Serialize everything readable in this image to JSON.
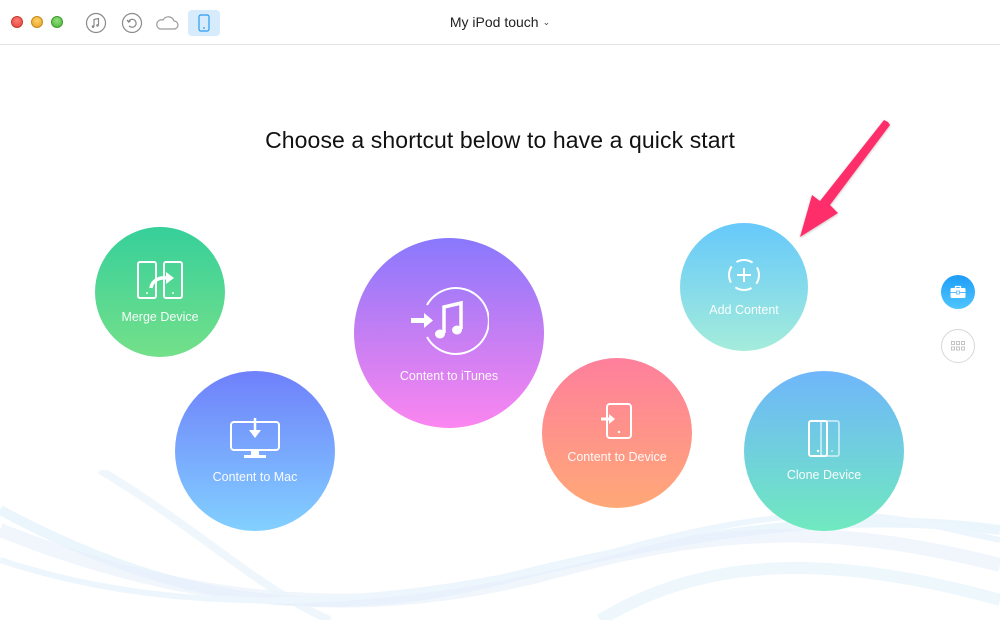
{
  "window": {
    "controls": [
      "close",
      "minimize",
      "maximize"
    ]
  },
  "toolbar": {
    "icons": [
      {
        "name": "itunes-library-icon",
        "active": false
      },
      {
        "name": "backup-restore-icon",
        "active": false
      },
      {
        "name": "icloud-icon",
        "active": false
      },
      {
        "name": "device-icon",
        "active": true
      }
    ],
    "device_name": "My iPod touch",
    "dropdown_glyph": "⌄"
  },
  "main": {
    "headline": "Choose a shortcut below to have a quick start",
    "shortcuts": [
      {
        "id": "merge-device",
        "label": "Merge Device",
        "gradient": [
          "#36cf9a",
          "#74e08a"
        ]
      },
      {
        "id": "content-to-mac",
        "label": "Content to Mac",
        "gradient": [
          "#6f80fb",
          "#82d0ff"
        ]
      },
      {
        "id": "content-to-itunes",
        "label": "Content to iTunes",
        "gradient": [
          "#8978fd",
          "#fb86f0"
        ]
      },
      {
        "id": "content-to-device",
        "label": "Content to Device",
        "gradient": [
          "#fe7f9c",
          "#ffa877"
        ]
      },
      {
        "id": "add-content",
        "label": "Add Content",
        "gradient": [
          "#66c9fb",
          "#a4ecdb"
        ]
      },
      {
        "id": "clone-device",
        "label": "Clone Device",
        "gradient": [
          "#6fb6fb",
          "#70e9bf"
        ]
      }
    ],
    "annotation_arrow_color": "#fe2d6b"
  },
  "sidebar": {
    "buttons": [
      {
        "name": "toolkit",
        "icon": "briefcase-icon",
        "active": true,
        "color": "#1e9cf8"
      },
      {
        "name": "apps",
        "icon": "grid-icon",
        "active": false
      }
    ]
  }
}
